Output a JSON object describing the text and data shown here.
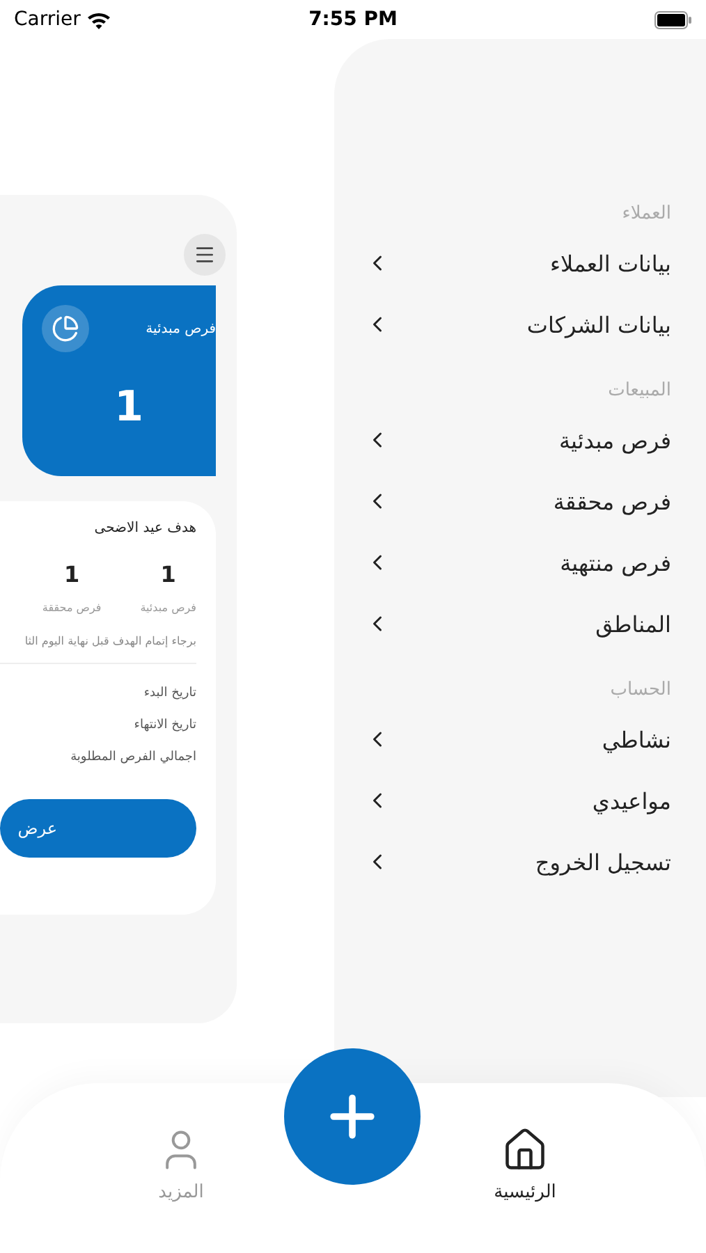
{
  "status_bar": {
    "carrier": "Carrier",
    "time": "7:55 PM"
  },
  "dashboard": {
    "summary_card": {
      "label": "فرص مبدئية",
      "value": "1"
    },
    "goal_card": {
      "title": "هدف عيد الاضحى",
      "stats": [
        {
          "value": "1",
          "label": "فرص مبدئية"
        },
        {
          "value": "1",
          "label": "فرص محققة"
        }
      ],
      "note": "برجاء إتمام الهدف قبل نهاية اليوم الثا",
      "fields": [
        "تاريخ البدء",
        "تاريخ الانتهاء",
        "اجمالي الفرص المطلوبة"
      ],
      "button": "عرض"
    }
  },
  "menu": {
    "sections": [
      {
        "title": "العملاء",
        "items": [
          {
            "label": "بيانات العملاء"
          },
          {
            "label": "بيانات الشركات"
          }
        ]
      },
      {
        "title": "المبيعات",
        "items": [
          {
            "label": "فرص مبدئية"
          },
          {
            "label": "فرص محققة"
          },
          {
            "label": "فرص منتهية"
          },
          {
            "label": "المناطق"
          }
        ]
      },
      {
        "title": "الحساب",
        "items": [
          {
            "label": "نشاطي"
          },
          {
            "label": "مواعيدي"
          },
          {
            "label": "تسجيل الخروج"
          }
        ]
      }
    ]
  },
  "tab_bar": {
    "items": [
      {
        "kind": "home",
        "label": "الرئيسية",
        "selected": true
      },
      {
        "kind": "more",
        "label": "المزيد",
        "selected": false
      }
    ]
  }
}
